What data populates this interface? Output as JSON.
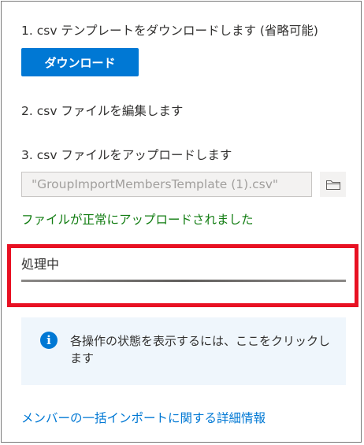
{
  "steps": {
    "step1": "1. csv テンプレートをダウンロードします (省略可能)",
    "download_button": "ダウンロード",
    "step2": "2. csv ファイルを編集します",
    "step3": "3. csv ファイルをアップロードします"
  },
  "upload": {
    "file_name": "\"GroupImportMembersTemplate (1).csv\"",
    "browse_icon": "folder-icon",
    "success_message": "ファイルが正常にアップロードされました"
  },
  "processing": {
    "label": "処理中",
    "progress_state": "indeterminate"
  },
  "info": {
    "icon": "info-icon",
    "message": "各操作の状態を表示するには、ここをクリックします"
  },
  "footer": {
    "link": "メンバーの一括インポートに関する詳細情報"
  },
  "colors": {
    "accent": "#0078d4",
    "success": "#107c10",
    "highlight": "#e81123",
    "info_background": "#eff6fc"
  }
}
